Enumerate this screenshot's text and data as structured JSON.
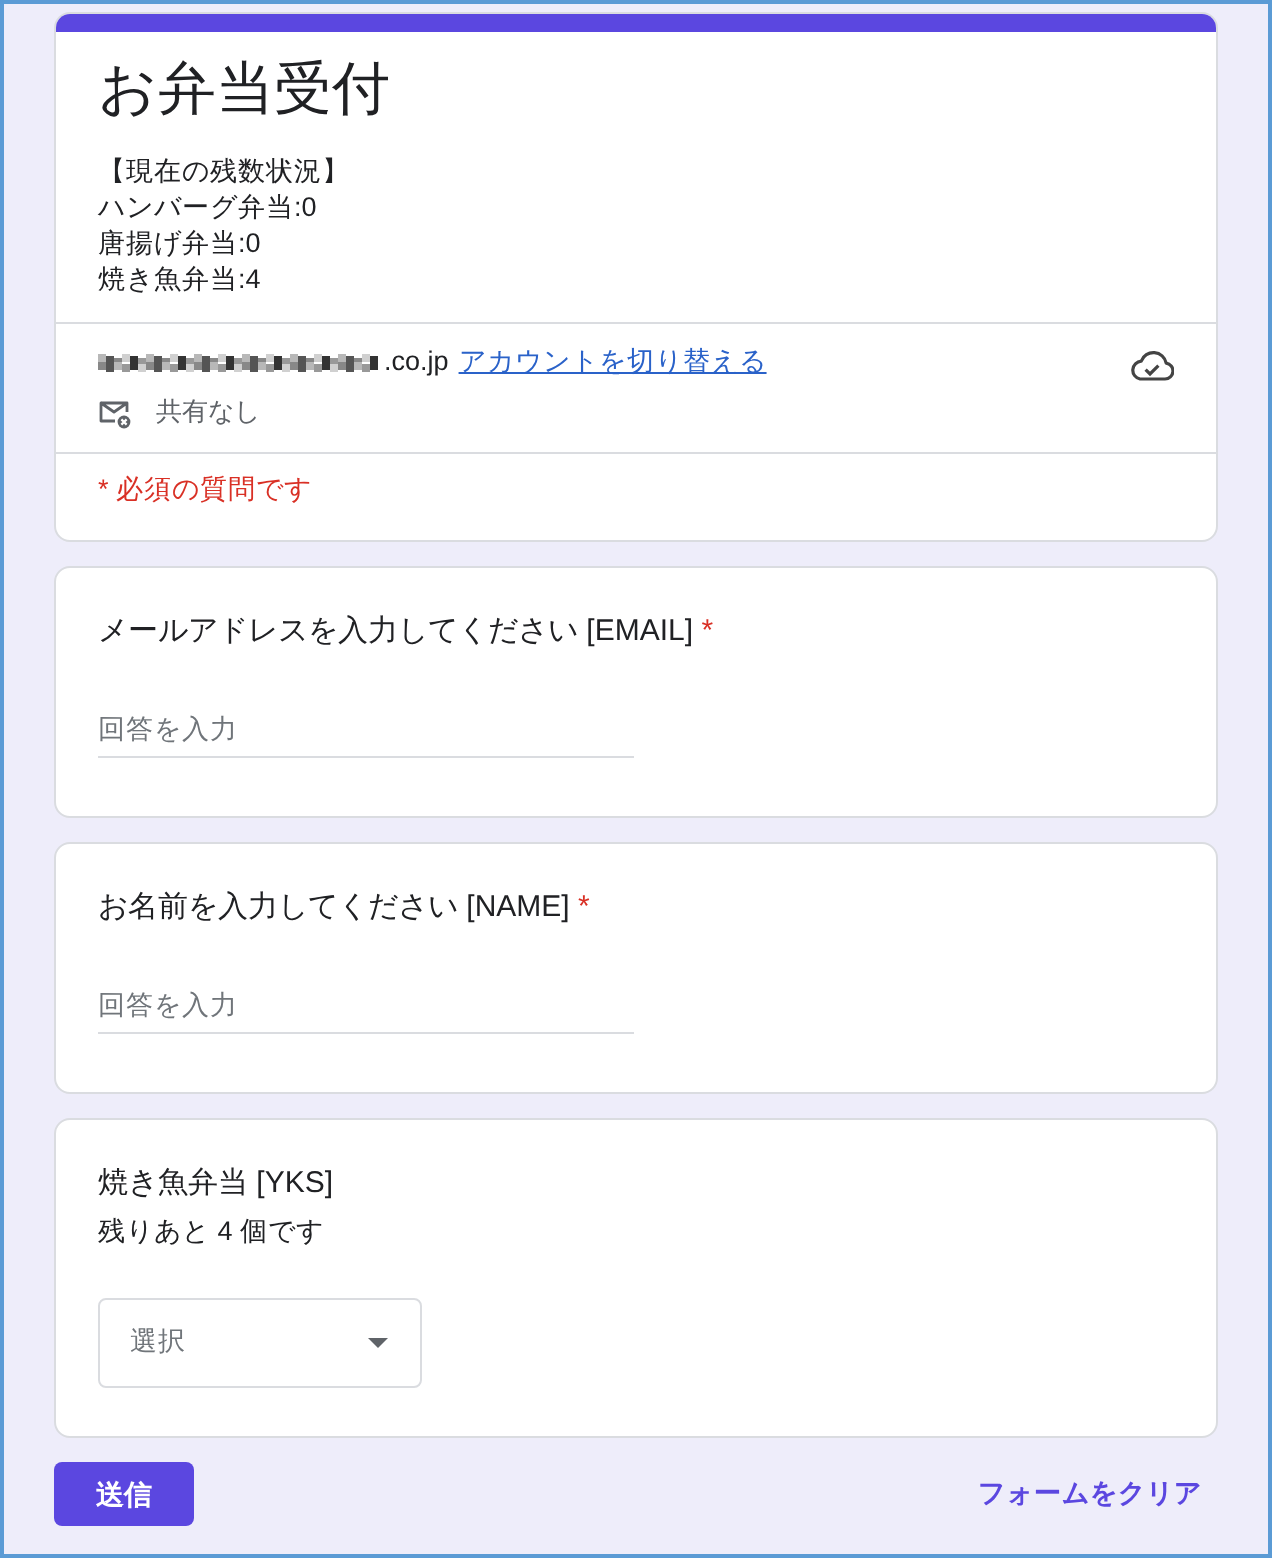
{
  "form": {
    "title": "お弁当受付",
    "description": [
      "【現在の残数状況】",
      "ハンバーグ弁当:0",
      "唐揚げ弁当:0",
      "焼き魚弁当:4"
    ]
  },
  "account": {
    "email_redacted": true,
    "email": ".co.jp",
    "switch_link": "アカウントを切り替える",
    "sharing": "共有なし",
    "saved": true
  },
  "required_note": "* 必須の質問です",
  "questions": [
    {
      "kind": "text",
      "label": "メールアドレスを入力してください [EMAIL]",
      "required_mark": "*",
      "placeholder": "回答を入力"
    },
    {
      "kind": "text",
      "label": "お名前を入力してください [NAME]",
      "required_mark": "*",
      "placeholder": "回答を入力"
    },
    {
      "kind": "dropdown",
      "label": "焼き魚弁当 [YKS]",
      "description": "残りあと 4 個です",
      "placeholder": "選択"
    }
  ],
  "actions": {
    "submit": "送信",
    "clear": "フォームをクリア"
  }
}
